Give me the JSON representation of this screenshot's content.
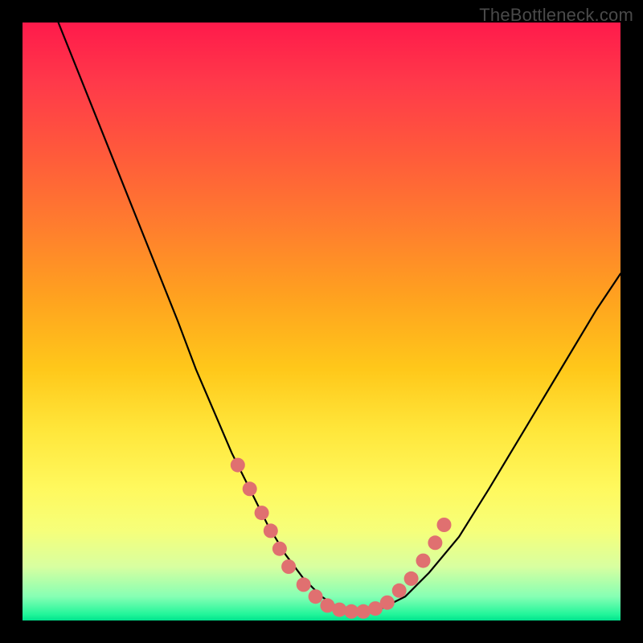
{
  "watermark": "TheBottleneck.com",
  "chart_data": {
    "type": "line",
    "title": "",
    "xlabel": "",
    "ylabel": "",
    "xlim": [
      0,
      100
    ],
    "ylim": [
      0,
      100
    ],
    "grid": false,
    "series": [
      {
        "name": "bottleneck-curve",
        "color": "#000000",
        "x": [
          6,
          10,
          14,
          18,
          22,
          26,
          29,
          32,
          35,
          38,
          41,
          44,
          47,
          50,
          53,
          56,
          60,
          64,
          68,
          73,
          78,
          84,
          90,
          96,
          100
        ],
        "values": [
          100,
          90,
          80,
          70,
          60,
          50,
          42,
          35,
          28,
          22,
          16,
          11,
          7,
          4,
          2,
          1,
          2,
          4,
          8,
          14,
          22,
          32,
          42,
          52,
          58
        ]
      }
    ],
    "markers": {
      "name": "highlighted-points",
      "color": "#e07070",
      "radius": 9,
      "points": [
        {
          "x": 36,
          "y": 26
        },
        {
          "x": 38,
          "y": 22
        },
        {
          "x": 40,
          "y": 18
        },
        {
          "x": 41.5,
          "y": 15
        },
        {
          "x": 43,
          "y": 12
        },
        {
          "x": 44.5,
          "y": 9
        },
        {
          "x": 47,
          "y": 6
        },
        {
          "x": 49,
          "y": 4
        },
        {
          "x": 51,
          "y": 2.5
        },
        {
          "x": 53,
          "y": 1.8
        },
        {
          "x": 55,
          "y": 1.5
        },
        {
          "x": 57,
          "y": 1.5
        },
        {
          "x": 59,
          "y": 2
        },
        {
          "x": 61,
          "y": 3
        },
        {
          "x": 63,
          "y": 5
        },
        {
          "x": 65,
          "y": 7
        },
        {
          "x": 67,
          "y": 10
        },
        {
          "x": 69,
          "y": 13
        },
        {
          "x": 70.5,
          "y": 16
        }
      ]
    },
    "gradient_stops": [
      {
        "pos": 0,
        "color": "#ff1a4b"
      },
      {
        "pos": 10,
        "color": "#ff394a"
      },
      {
        "pos": 22,
        "color": "#ff5a3b"
      },
      {
        "pos": 34,
        "color": "#ff7d2e"
      },
      {
        "pos": 46,
        "color": "#ffa21f"
      },
      {
        "pos": 58,
        "color": "#ffc81a"
      },
      {
        "pos": 68,
        "color": "#ffe63a"
      },
      {
        "pos": 78,
        "color": "#fff95e"
      },
      {
        "pos": 85,
        "color": "#f6ff7a"
      },
      {
        "pos": 91,
        "color": "#d8ffa0"
      },
      {
        "pos": 96,
        "color": "#86ffb4"
      },
      {
        "pos": 99,
        "color": "#21f59a"
      },
      {
        "pos": 100,
        "color": "#00e28d"
      }
    ]
  }
}
